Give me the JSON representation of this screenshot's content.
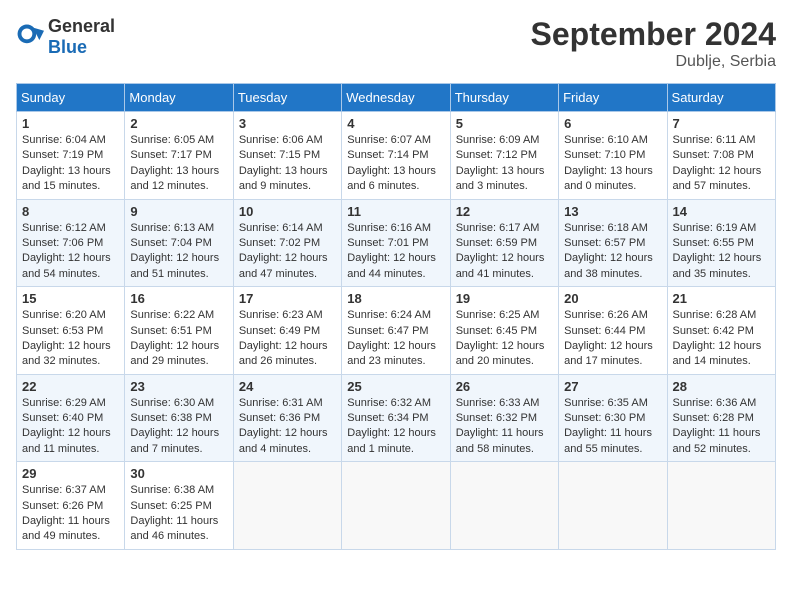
{
  "header": {
    "logo_general": "General",
    "logo_blue": "Blue",
    "month_year": "September 2024",
    "location": "Dublje, Serbia"
  },
  "weekdays": [
    "Sunday",
    "Monday",
    "Tuesday",
    "Wednesday",
    "Thursday",
    "Friday",
    "Saturday"
  ],
  "weeks": [
    [
      {
        "day": "1",
        "sunrise": "Sunrise: 6:04 AM",
        "sunset": "Sunset: 7:19 PM",
        "daylight": "Daylight: 13 hours and 15 minutes."
      },
      {
        "day": "2",
        "sunrise": "Sunrise: 6:05 AM",
        "sunset": "Sunset: 7:17 PM",
        "daylight": "Daylight: 13 hours and 12 minutes."
      },
      {
        "day": "3",
        "sunrise": "Sunrise: 6:06 AM",
        "sunset": "Sunset: 7:15 PM",
        "daylight": "Daylight: 13 hours and 9 minutes."
      },
      {
        "day": "4",
        "sunrise": "Sunrise: 6:07 AM",
        "sunset": "Sunset: 7:14 PM",
        "daylight": "Daylight: 13 hours and 6 minutes."
      },
      {
        "day": "5",
        "sunrise": "Sunrise: 6:09 AM",
        "sunset": "Sunset: 7:12 PM",
        "daylight": "Daylight: 13 hours and 3 minutes."
      },
      {
        "day": "6",
        "sunrise": "Sunrise: 6:10 AM",
        "sunset": "Sunset: 7:10 PM",
        "daylight": "Daylight: 13 hours and 0 minutes."
      },
      {
        "day": "7",
        "sunrise": "Sunrise: 6:11 AM",
        "sunset": "Sunset: 7:08 PM",
        "daylight": "Daylight: 12 hours and 57 minutes."
      }
    ],
    [
      {
        "day": "8",
        "sunrise": "Sunrise: 6:12 AM",
        "sunset": "Sunset: 7:06 PM",
        "daylight": "Daylight: 12 hours and 54 minutes."
      },
      {
        "day": "9",
        "sunrise": "Sunrise: 6:13 AM",
        "sunset": "Sunset: 7:04 PM",
        "daylight": "Daylight: 12 hours and 51 minutes."
      },
      {
        "day": "10",
        "sunrise": "Sunrise: 6:14 AM",
        "sunset": "Sunset: 7:02 PM",
        "daylight": "Daylight: 12 hours and 47 minutes."
      },
      {
        "day": "11",
        "sunrise": "Sunrise: 6:16 AM",
        "sunset": "Sunset: 7:01 PM",
        "daylight": "Daylight: 12 hours and 44 minutes."
      },
      {
        "day": "12",
        "sunrise": "Sunrise: 6:17 AM",
        "sunset": "Sunset: 6:59 PM",
        "daylight": "Daylight: 12 hours and 41 minutes."
      },
      {
        "day": "13",
        "sunrise": "Sunrise: 6:18 AM",
        "sunset": "Sunset: 6:57 PM",
        "daylight": "Daylight: 12 hours and 38 minutes."
      },
      {
        "day": "14",
        "sunrise": "Sunrise: 6:19 AM",
        "sunset": "Sunset: 6:55 PM",
        "daylight": "Daylight: 12 hours and 35 minutes."
      }
    ],
    [
      {
        "day": "15",
        "sunrise": "Sunrise: 6:20 AM",
        "sunset": "Sunset: 6:53 PM",
        "daylight": "Daylight: 12 hours and 32 minutes."
      },
      {
        "day": "16",
        "sunrise": "Sunrise: 6:22 AM",
        "sunset": "Sunset: 6:51 PM",
        "daylight": "Daylight: 12 hours and 29 minutes."
      },
      {
        "day": "17",
        "sunrise": "Sunrise: 6:23 AM",
        "sunset": "Sunset: 6:49 PM",
        "daylight": "Daylight: 12 hours and 26 minutes."
      },
      {
        "day": "18",
        "sunrise": "Sunrise: 6:24 AM",
        "sunset": "Sunset: 6:47 PM",
        "daylight": "Daylight: 12 hours and 23 minutes."
      },
      {
        "day": "19",
        "sunrise": "Sunrise: 6:25 AM",
        "sunset": "Sunset: 6:45 PM",
        "daylight": "Daylight: 12 hours and 20 minutes."
      },
      {
        "day": "20",
        "sunrise": "Sunrise: 6:26 AM",
        "sunset": "Sunset: 6:44 PM",
        "daylight": "Daylight: 12 hours and 17 minutes."
      },
      {
        "day": "21",
        "sunrise": "Sunrise: 6:28 AM",
        "sunset": "Sunset: 6:42 PM",
        "daylight": "Daylight: 12 hours and 14 minutes."
      }
    ],
    [
      {
        "day": "22",
        "sunrise": "Sunrise: 6:29 AM",
        "sunset": "Sunset: 6:40 PM",
        "daylight": "Daylight: 12 hours and 11 minutes."
      },
      {
        "day": "23",
        "sunrise": "Sunrise: 6:30 AM",
        "sunset": "Sunset: 6:38 PM",
        "daylight": "Daylight: 12 hours and 7 minutes."
      },
      {
        "day": "24",
        "sunrise": "Sunrise: 6:31 AM",
        "sunset": "Sunset: 6:36 PM",
        "daylight": "Daylight: 12 hours and 4 minutes."
      },
      {
        "day": "25",
        "sunrise": "Sunrise: 6:32 AM",
        "sunset": "Sunset: 6:34 PM",
        "daylight": "Daylight: 12 hours and 1 minute."
      },
      {
        "day": "26",
        "sunrise": "Sunrise: 6:33 AM",
        "sunset": "Sunset: 6:32 PM",
        "daylight": "Daylight: 11 hours and 58 minutes."
      },
      {
        "day": "27",
        "sunrise": "Sunrise: 6:35 AM",
        "sunset": "Sunset: 6:30 PM",
        "daylight": "Daylight: 11 hours and 55 minutes."
      },
      {
        "day": "28",
        "sunrise": "Sunrise: 6:36 AM",
        "sunset": "Sunset: 6:28 PM",
        "daylight": "Daylight: 11 hours and 52 minutes."
      }
    ],
    [
      {
        "day": "29",
        "sunrise": "Sunrise: 6:37 AM",
        "sunset": "Sunset: 6:26 PM",
        "daylight": "Daylight: 11 hours and 49 minutes."
      },
      {
        "day": "30",
        "sunrise": "Sunrise: 6:38 AM",
        "sunset": "Sunset: 6:25 PM",
        "daylight": "Daylight: 11 hours and 46 minutes."
      },
      null,
      null,
      null,
      null,
      null
    ]
  ]
}
